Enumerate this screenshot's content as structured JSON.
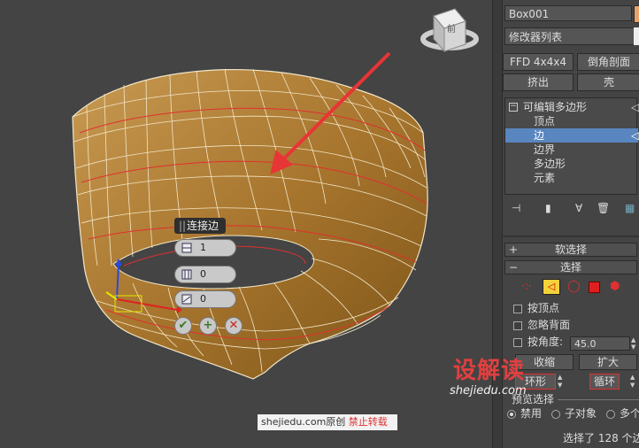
{
  "viewport": {
    "popup": {
      "title": "连接边",
      "segments_value": "1",
      "pinch_value": "0",
      "slide_value": "0",
      "ok_icon": "checkmark-icon",
      "apply_icon": "plus-icon",
      "cancel_icon": "x-icon"
    },
    "viewcube_label": "前",
    "watermark": {
      "site": "shejiedu.com原创",
      "notice": "禁止转载"
    },
    "logo": {
      "text": "设解读",
      "sub": "shejiedu.com"
    }
  },
  "panel": {
    "object_name": "Box001",
    "modifier_list": "修改器列表",
    "buttons": {
      "ffd": "FFD 4x4x4",
      "chamfer_profile": "倒角剖面",
      "extrude": "挤出",
      "shell": "壳"
    },
    "stack": {
      "root": "可编辑多边形",
      "items": [
        "顶点",
        "边",
        "边界",
        "多边形",
        "元素"
      ],
      "selected_index": 1
    },
    "rollouts": {
      "soft_selection": "软选择",
      "selection": "选择"
    },
    "options": {
      "by_vertex": "按顶点",
      "ignore_backfacing": "忽略背面",
      "by_angle": "按角度:",
      "angle_value": "45.0"
    },
    "grow_shrink": {
      "shrink": "收缩",
      "grow": "扩大"
    },
    "ring_loop": {
      "ring": "环形",
      "loop": "循环"
    },
    "preview": {
      "label": "预览选择",
      "disabled": "禁用",
      "subobject": "子对象",
      "multi": "多个"
    },
    "status": "选择了 128 个边",
    "colors": {
      "highlight": "#5a86c0",
      "accent_red": "#e03030"
    }
  }
}
